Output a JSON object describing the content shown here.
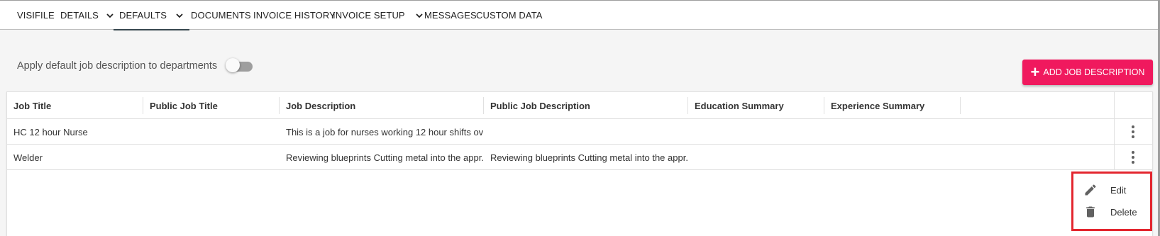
{
  "tabs": [
    {
      "label": "VISIFILE",
      "has_dropdown": false
    },
    {
      "label": "DETAILS",
      "has_dropdown": true
    },
    {
      "label": "DEFAULTS",
      "has_dropdown": true,
      "active": true
    },
    {
      "label": "DOCUMENTS",
      "has_dropdown": false
    },
    {
      "label": "INVOICE HISTORY",
      "has_dropdown": false
    },
    {
      "label": "INVOICE SETUP",
      "has_dropdown": true
    },
    {
      "label": "MESSAGES",
      "has_dropdown": false
    },
    {
      "label": "CUSTOM DATA",
      "has_dropdown": false
    }
  ],
  "toggle": {
    "label": "Apply default job description to departments",
    "state": "off"
  },
  "add_button": {
    "label": "ADD JOB DESCRIPTION",
    "icon": "plus-icon"
  },
  "table": {
    "columns": [
      "Job Title",
      "Public Job Title",
      "Job Description",
      "Public Job Description",
      "Education Summary",
      "Experience Summary"
    ],
    "rows": [
      {
        "job_title": "HC 12 hour Nurse",
        "public_job_title": "",
        "job_description": "This is a job for nurses working 12 hour shifts ov...",
        "public_job_description": "",
        "education_summary": "",
        "experience_summary": ""
      },
      {
        "job_title": "Welder",
        "public_job_title": "",
        "job_description": "Reviewing blueprints Cutting metal into the appr...",
        "public_job_description": "Reviewing blueprints Cutting metal into the appr...",
        "education_summary": "",
        "experience_summary": ""
      }
    ]
  },
  "context_menu": {
    "items": [
      {
        "label": "Edit",
        "icon": "pencil-icon"
      },
      {
        "label": "Delete",
        "icon": "trash-icon"
      }
    ]
  },
  "colors": {
    "accent": "#f0195e",
    "highlight_border": "#e3262f",
    "active_tab_underline": "#37474f"
  }
}
